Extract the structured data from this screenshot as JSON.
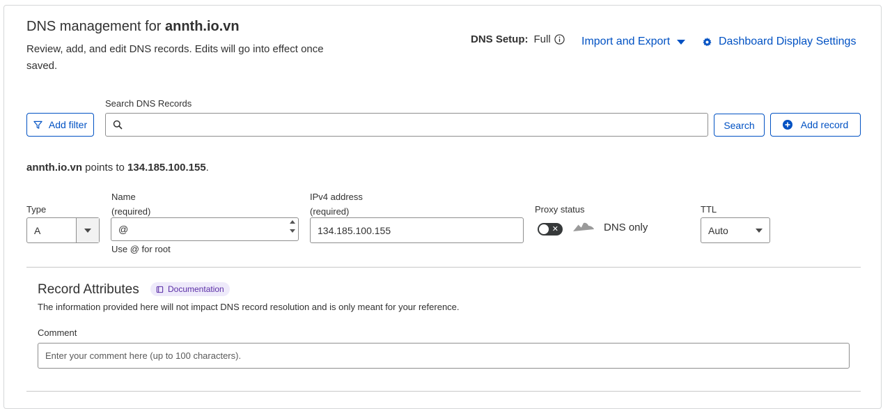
{
  "header": {
    "title_prefix": "DNS management for ",
    "domain": "annth.io.vn",
    "subtitle": "Review, add, and edit DNS records. Edits will go into effect once saved.",
    "dns_setup_label": "DNS Setup:",
    "dns_setup_value": "Full",
    "import_export": "Import and Export",
    "dashboard_settings": "Dashboard Display Settings"
  },
  "toolbar": {
    "add_filter": "Add filter",
    "search_label": "Search DNS Records",
    "search_value": "",
    "search_button": "Search",
    "add_record": "Add record"
  },
  "points_to": {
    "domain": "annth.io.vn",
    "text": " points to ",
    "ip": "134.185.100.155",
    "end": "."
  },
  "record_form": {
    "type_label": "Type",
    "type_value": "A",
    "name_label_1": "Name",
    "name_label_2": "(required)",
    "name_value": "@",
    "name_hint": "Use @ for root",
    "ip_label_1": "IPv4 address",
    "ip_label_2": "(required)",
    "ip_value": "134.185.100.155",
    "proxy_label": "Proxy status",
    "proxy_state": "DNS only",
    "ttl_label": "TTL",
    "ttl_value": "Auto"
  },
  "attributes": {
    "title": "Record Attributes",
    "doc_badge": "Documentation",
    "description": "The information provided here will not impact DNS record resolution and is only meant for your reference.",
    "comment_label": "Comment",
    "comment_placeholder": "Enter your comment here (up to 100 characters)."
  },
  "colors": {
    "link": "#0051c3",
    "badge_bg": "#eeeafa",
    "badge_text": "#5a2ea6",
    "toggle_off": "#36393a"
  },
  "icons": [
    "info-icon",
    "chevron-down-icon",
    "gear-icon",
    "filter-icon",
    "search-icon",
    "plus-circle-icon",
    "cloud-icon",
    "book-icon"
  ]
}
